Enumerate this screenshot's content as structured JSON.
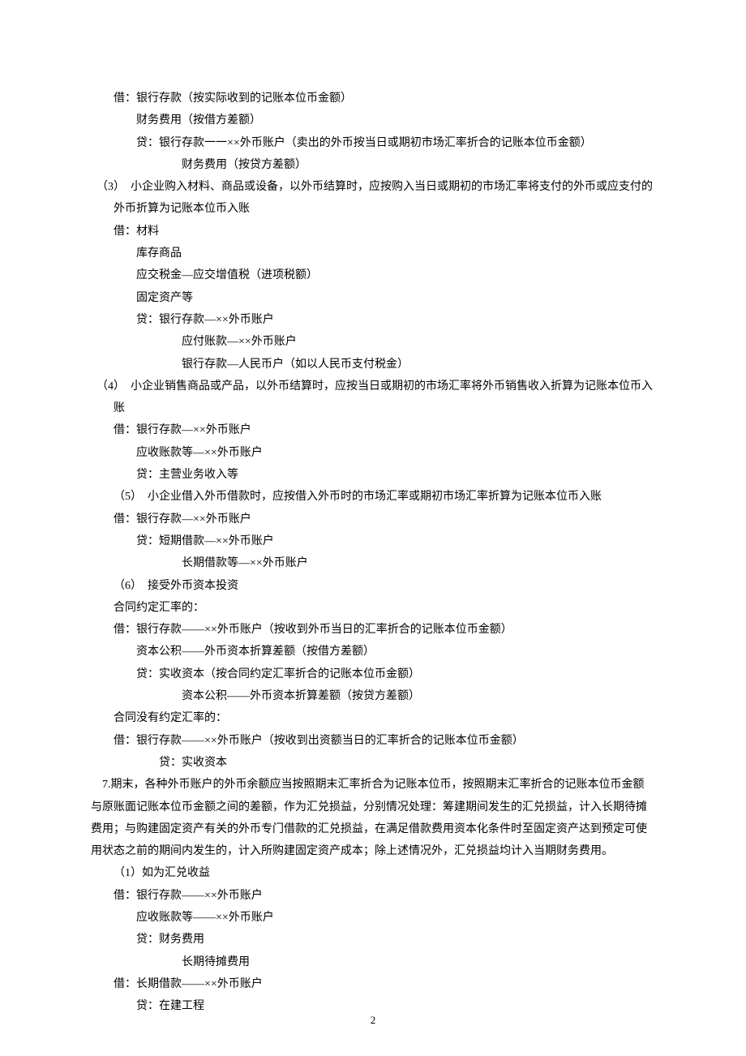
{
  "lines": [
    {
      "cls": "ind1",
      "t": "借：银行存款（按实际收到的记账本位币金额）"
    },
    {
      "cls": "ind2",
      "t": "财务费用（按借方差额）"
    },
    {
      "cls": "ind2",
      "t": "贷：银行存款一一××外币账户（卖出的外币按当日或期初市场汇率折合的记账本位币金额）"
    },
    {
      "cls": "ind4",
      "t": "财务费用（按贷方差额）"
    },
    {
      "cls": "hang",
      "t": "　（3）　小企业购入材料、商品或设备，以外币结算时，应按购入当日或期初的市场汇率将支付的外币或应支付的外币折算为记账本位币入账"
    },
    {
      "cls": "ind1",
      "t": "借：材料"
    },
    {
      "cls": "ind2",
      "t": "库存商品"
    },
    {
      "cls": "ind2",
      "t": "应交税金—应交增值税（进项税额）"
    },
    {
      "cls": "ind2",
      "t": "固定资产等"
    },
    {
      "cls": "ind2",
      "t": "贷：银行存款—××外币账户"
    },
    {
      "cls": "ind4",
      "t": "应付账款—××外币账户"
    },
    {
      "cls": "ind4",
      "t": "银行存款—人民币户（如以人民币支付税金）"
    },
    {
      "cls": "hang",
      "t": "　（4）　小企业销售商品或产品，以外币结算时，应按当日或期初的市场汇率将外币销售收入折算为记账本位币入账"
    },
    {
      "cls": "ind1",
      "t": "借：银行存款—××外币账户"
    },
    {
      "cls": "ind2",
      "t": "应收账款等—××外币账户"
    },
    {
      "cls": "ind2",
      "t": "贷：主营业务收入等"
    },
    {
      "cls": "ind1",
      "t": "（5）　小企业借入外币借款时，应按借入外币时的市场汇率或期初市场汇率折算为记账本位币入账"
    },
    {
      "cls": "ind1",
      "t": "借：银行存款—××外币账户"
    },
    {
      "cls": "ind2",
      "t": "贷：短期借款—××外币账户"
    },
    {
      "cls": "ind4",
      "t": "长期借款等—××外币账户"
    },
    {
      "cls": "ind1",
      "t": "（6）　接受外币资本投资"
    },
    {
      "cls": "ind1",
      "t": "合同约定汇率的："
    },
    {
      "cls": "ind1",
      "t": "借：银行存款——××外币账户（按收到外币当日的汇率折合的记账本位币金额）"
    },
    {
      "cls": "ind2",
      "t": "资本公积——外币资本折算差额（按借方差额）"
    },
    {
      "cls": "ind2",
      "t": "贷：实收资本（按合同约定汇率折合的记账本位币金额）"
    },
    {
      "cls": "ind4",
      "t": "资本公积——外币资本折算差额（按贷方差额）"
    },
    {
      "cls": "ind1",
      "t": "合同没有约定汇率的："
    },
    {
      "cls": "ind1",
      "t": "借：银行存款——××外币账户（按收到出资额当日的汇率折合的记账本位币金额）"
    },
    {
      "cls": "ind3",
      "t": "贷：实收资本"
    },
    {
      "cls": "ind0",
      "t": "7.期末，各种外币账户的外币余额应当按照期末汇率折合为记账本位币，按照期末汇率折合的记账本位币金额与原账面记账本位币金额之间的差额，作为汇兑损益，分别情况处理：筹建期间发生的汇兑损益，计入长期待摊费用；与购建固定资产有关的外币专门借款的汇兑损益，在满足借款费用资本化条件时至固定资产达到预定可使用状态之前的期间内发生的，计入所购建固定资产成本；除上述情况外，汇兑损益均计入当期财务费用。"
    },
    {
      "cls": "ind1",
      "t": "（1）如为汇兑收益"
    },
    {
      "cls": "ind1",
      "t": "借：银行存款——××外币账户"
    },
    {
      "cls": "ind2",
      "t": "应收账款等——××外币账户"
    },
    {
      "cls": "ind2",
      "t": "贷：财务费用"
    },
    {
      "cls": "ind4",
      "t": "长期待摊费用"
    },
    {
      "cls": "ind1",
      "t": "借：长期借款——××外币账户"
    },
    {
      "cls": "ind2",
      "t": "贷：在建工程"
    }
  ],
  "pageNumber": "2"
}
